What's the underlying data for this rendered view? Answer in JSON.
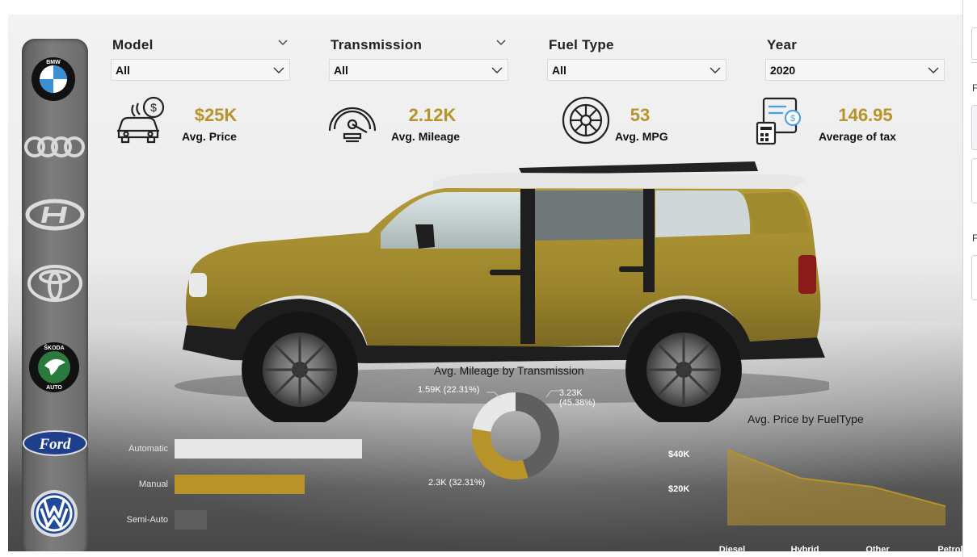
{
  "slicers": [
    {
      "title": "Model",
      "value": "All"
    },
    {
      "title": "Transmission",
      "value": "All"
    },
    {
      "title": "Fuel Type",
      "value": "All"
    },
    {
      "title": "Year",
      "value": "2020"
    }
  ],
  "kpis": [
    {
      "value": "$25K",
      "label": "Avg. Price",
      "icon": "car-dollar-icon"
    },
    {
      "value": "2.12K",
      "label": "Avg. Mileage",
      "icon": "speedometer-icon"
    },
    {
      "value": "53",
      "label": "Avg. MPG",
      "icon": "tire-icon"
    },
    {
      "value": "146.95",
      "label": "Average of tax",
      "icon": "tax-calculator-icon"
    }
  ],
  "brands": [
    {
      "name": "BMW",
      "icon": "bmw-logo-icon",
      "text": "BMW"
    },
    {
      "name": "Audi",
      "icon": "audi-logo-icon"
    },
    {
      "name": "Hyundai",
      "icon": "hyundai-logo-icon"
    },
    {
      "name": "Toyota",
      "icon": "toyota-logo-icon"
    },
    {
      "name": "Skoda",
      "icon": "skoda-logo-icon",
      "text_top": "ŠKODA",
      "text_bottom": "AUTO"
    },
    {
      "name": "Ford",
      "icon": "ford-logo-icon",
      "text": "Ford"
    },
    {
      "name": "Volkswagen",
      "icon": "vw-logo-icon"
    }
  ],
  "right_pane": {
    "letter1": "F",
    "letter2": "F"
  },
  "colors": {
    "gold": "#b8932a",
    "light": "#e8e8e8",
    "dark": "#5f5f5f",
    "car_body": "#a08a2e"
  },
  "chart_data": [
    {
      "type": "bar",
      "orientation": "horizontal",
      "title": "",
      "categories": [
        "Automatic",
        "Manual",
        "Semi-Auto"
      ],
      "values": [
        2.3,
        1.6,
        0.4
      ],
      "colors": [
        "#e8e8e8",
        "#b8932a",
        "#5f5f5f"
      ]
    },
    {
      "type": "pie",
      "donut": true,
      "title": "Avg. Mileage by Transmission",
      "slices": [
        {
          "label": "3.23K (45.38%)",
          "value": 3.23,
          "percent": 45.38,
          "color": "#5f5f5f"
        },
        {
          "label": "2.3K (32.31%)",
          "value": 2.3,
          "percent": 32.31,
          "color": "#b8932a"
        },
        {
          "label": "1.59K (22.31%)",
          "value": 1.59,
          "percent": 22.31,
          "color": "#e8e8e8"
        }
      ]
    },
    {
      "type": "area",
      "title": "Avg. Price by FuelType",
      "categories": [
        "Diesel",
        "Hybrid",
        "Other",
        "Petrol"
      ],
      "values": [
        43,
        27,
        22,
        11
      ],
      "ytick_labels": [
        "$40K",
        "$20K"
      ],
      "ytick_values": [
        40,
        20
      ],
      "ylim": [
        0,
        45
      ],
      "color": "#b8932a"
    }
  ]
}
